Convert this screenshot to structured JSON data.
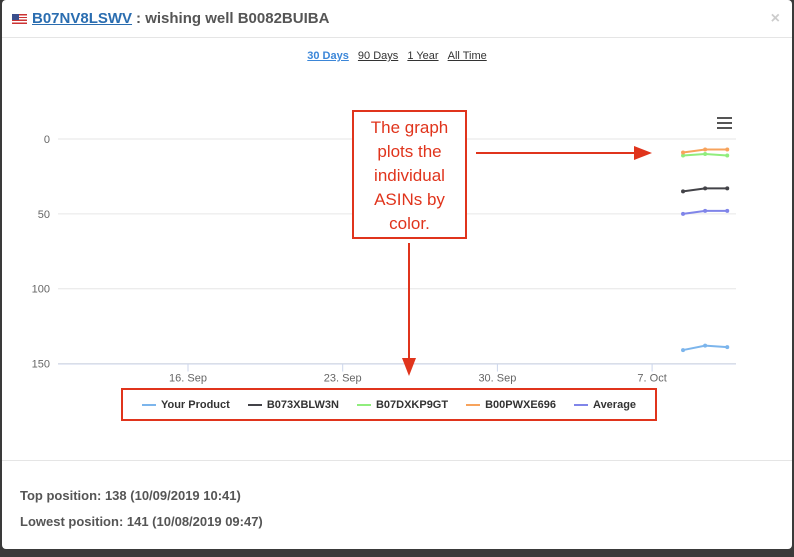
{
  "header": {
    "asin_link": "B07NV8LSWV",
    "title": ": wishing well B0082BUIBA",
    "close": "×"
  },
  "ranges": [
    "30 Days",
    "90 Days",
    "1 Year",
    "All Time"
  ],
  "annotation": {
    "callout": "The graph plots the individual ASINs by color."
  },
  "footer": {
    "top_position": "Top position: 138 (10/09/2019 10:41)",
    "lowest_position": "Lowest position: 141 (10/08/2019 09:47)"
  },
  "chart_data": {
    "type": "line",
    "title": "",
    "x_unit": "day of Sep 2019 (days after Sep 30 continue into Oct)",
    "xticks": [
      {
        "x": 16,
        "label": "16. Sep"
      },
      {
        "x": 23,
        "label": "23. Sep"
      },
      {
        "x": 30,
        "label": "30. Sep"
      },
      {
        "x": 37,
        "label": "7. Oct"
      }
    ],
    "yticks": [
      0,
      50,
      100,
      150
    ],
    "ylim": [
      0,
      150
    ],
    "y_reversed": true,
    "grid": true,
    "legend": "bottom",
    "x": [
      38.4,
      39.4,
      40.4
    ],
    "series": [
      {
        "name": "Your Product",
        "color": "#7cb5ec",
        "values": [
          141,
          138,
          139
        ]
      },
      {
        "name": "B073XBLW3N",
        "color": "#434348",
        "values": [
          35,
          33,
          33
        ]
      },
      {
        "name": "B07DXKP9GT",
        "color": "#90ed7d",
        "values": [
          11,
          10,
          11
        ]
      },
      {
        "name": "B00PWXE696",
        "color": "#f7a35c",
        "values": [
          9,
          7,
          7
        ]
      },
      {
        "name": "Average",
        "color": "#8085e9",
        "values": [
          50,
          48,
          48
        ]
      }
    ]
  }
}
